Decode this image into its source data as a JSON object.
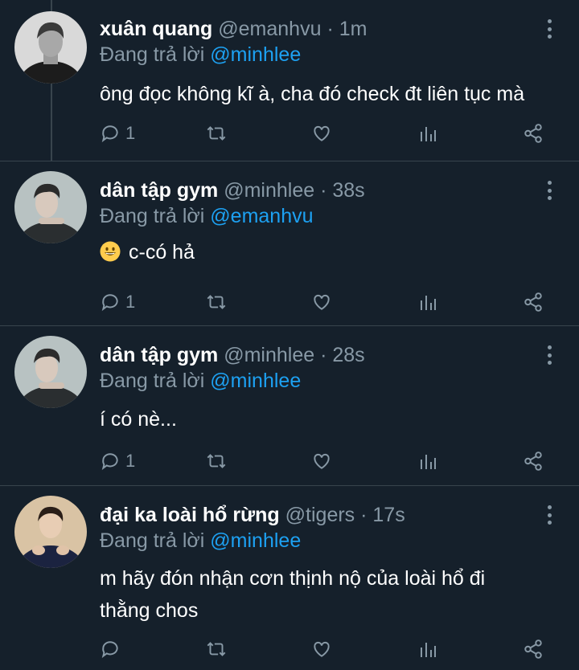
{
  "tweets": [
    {
      "display_name": "xuân quang",
      "handle": "@emanhvu",
      "separator": "·",
      "time": "1m",
      "reply_prefix": "Đang trả lời",
      "reply_to": "@minhlee",
      "text": "ông đọc không kĩ à, cha đó check đt liên tục mà",
      "reply_count": "1",
      "avatar_style": "dark-gray"
    },
    {
      "display_name": "dân tập gym",
      "handle": "@minhlee",
      "separator": "·",
      "time": "38s",
      "reply_prefix": "Đang trả lời",
      "reply_to": "@emanhvu",
      "text": "c-có hả",
      "emoji": "grinning-face",
      "reply_count": "1",
      "avatar_style": "teal-gray"
    },
    {
      "display_name": "dân tập gym",
      "handle": "@minhlee",
      "separator": "·",
      "time": "28s",
      "reply_prefix": "Đang trả lời",
      "reply_to": "@minhlee",
      "text": "í có nè...",
      "reply_count": "1",
      "avatar_style": "teal-gray"
    },
    {
      "display_name": "đại ka loài hổ rừng",
      "handle": "@tigers",
      "separator": "·",
      "time": "17s",
      "reply_prefix": "Đang trả lời",
      "reply_to": "@minhlee",
      "text": "m hãy đón nhận cơn thịnh nộ của loài hổ đi thằng chos",
      "reply_count": "",
      "avatar_style": "warm-beige"
    }
  ],
  "icons": {
    "reply": "reply-icon",
    "retweet": "retweet-icon",
    "like": "like-icon",
    "analytics": "analytics-icon",
    "share": "share-icon",
    "more": "more-vertical-icon"
  },
  "colors": {
    "background": "#15202b",
    "muted": "#8899a6",
    "link": "#1da1f2",
    "divider": "#38444d"
  }
}
